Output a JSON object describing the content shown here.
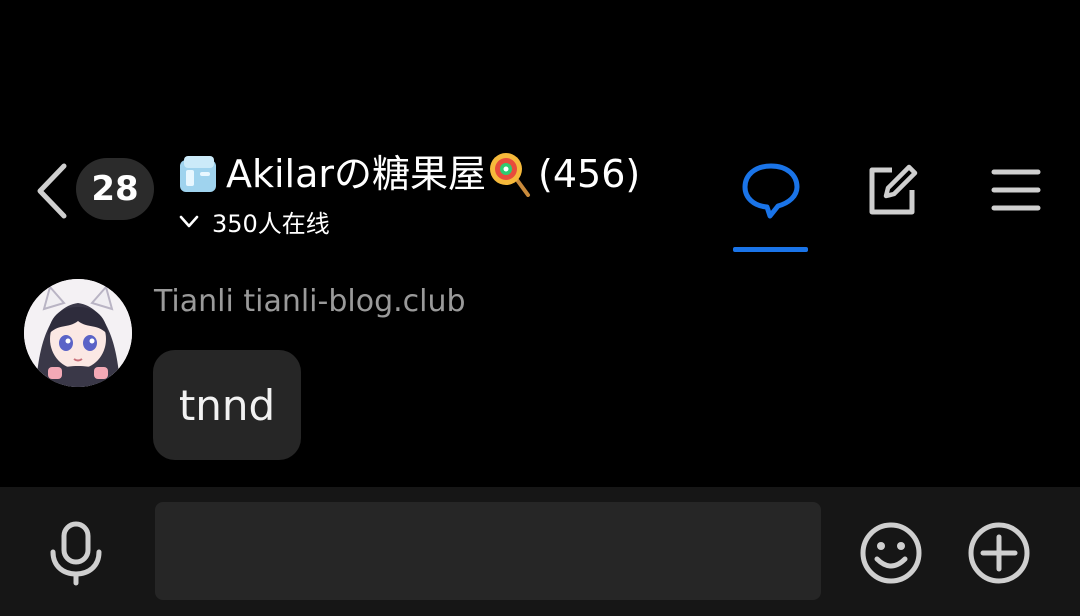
{
  "header": {
    "unread_count": "28",
    "group_name": "Akilarの糖果屋",
    "member_count": "(456)",
    "online_text": "350人在线",
    "title_emoji_left": "ice-cube",
    "title_emoji_right": "lollipop"
  },
  "message": {
    "sender": "Tianli tianli-blog.club",
    "text": "tnnd"
  },
  "composer": {
    "placeholder": "",
    "value": ""
  },
  "colors": {
    "accent": "#1a74e8",
    "background": "#000000",
    "bubble": "#262626",
    "bottom_bar": "#161616"
  }
}
